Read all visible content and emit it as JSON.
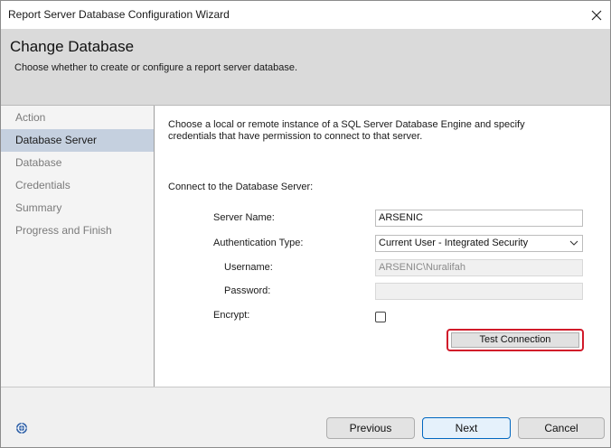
{
  "window": {
    "title": "Report Server Database Configuration Wizard"
  },
  "header": {
    "title": "Change Database",
    "subtitle": "Choose whether to create or configure a report server database."
  },
  "sidebar": {
    "items": [
      {
        "label": "Action",
        "active": false
      },
      {
        "label": "Database Server",
        "active": true
      },
      {
        "label": "Database",
        "active": false
      },
      {
        "label": "Credentials",
        "active": false
      },
      {
        "label": "Summary",
        "active": false
      },
      {
        "label": "Progress and Finish",
        "active": false
      }
    ]
  },
  "content": {
    "description": "Choose a local or remote instance of a SQL Server Database Engine and specify credentials that have permission to connect to that server.",
    "connect_label": "Connect to the Database Server:",
    "server_name_label": "Server Name:",
    "server_name_value": "ARSENIC",
    "auth_type_label": "Authentication Type:",
    "auth_type_value": "Current User - Integrated Security",
    "username_label": "Username:",
    "username_value": "ARSENIC\\Nuralifah",
    "password_label": "Password:",
    "password_value": "",
    "encrypt_label": "Encrypt:",
    "encrypt_checked": false,
    "test_connection_label": "Test Connection"
  },
  "footer": {
    "previous_label": "Previous",
    "next_label": "Next",
    "cancel_label": "Cancel"
  },
  "colors": {
    "highlight_border": "#d11a2a",
    "sidebar_selected": "#c5d0df",
    "primary_button_border": "#0067c0"
  },
  "icons": {
    "close": "close-icon",
    "dropdown": "chevron-down-icon",
    "help": "help-icon"
  }
}
